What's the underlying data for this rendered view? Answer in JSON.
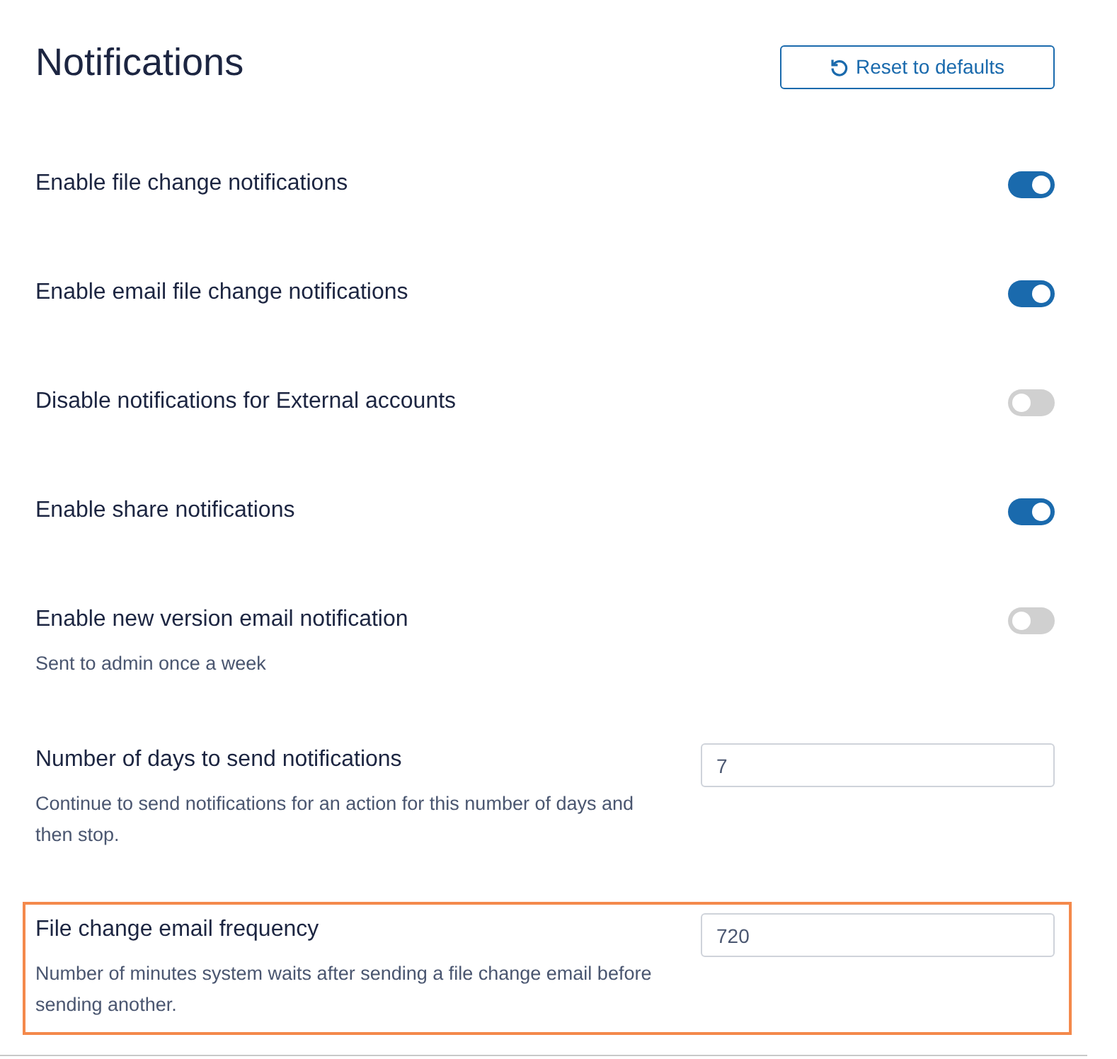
{
  "title": "Notifications",
  "reset_button": {
    "label": "Reset to defaults"
  },
  "settings": [
    {
      "kind": "toggle",
      "label": "Enable file change notifications",
      "on": true
    },
    {
      "kind": "toggle",
      "label": "Enable email file change notifications",
      "on": true
    },
    {
      "kind": "toggle",
      "label": "Disable notifications for External accounts",
      "on": false
    },
    {
      "kind": "toggle",
      "label": "Enable share notifications",
      "on": true
    },
    {
      "kind": "toggle",
      "label": "Enable new version email notification",
      "help": "Sent to admin once a week",
      "on": false
    },
    {
      "kind": "number",
      "label": "Number of days to send notifications",
      "help": "Continue to send notifications for an action for this number of days and then stop.",
      "value": "7",
      "highlighted": false
    },
    {
      "kind": "number",
      "label": "File change email frequency",
      "help": "Number of minutes system waits after sending a file change email before sending another.",
      "value": "720",
      "highlighted": true
    }
  ]
}
